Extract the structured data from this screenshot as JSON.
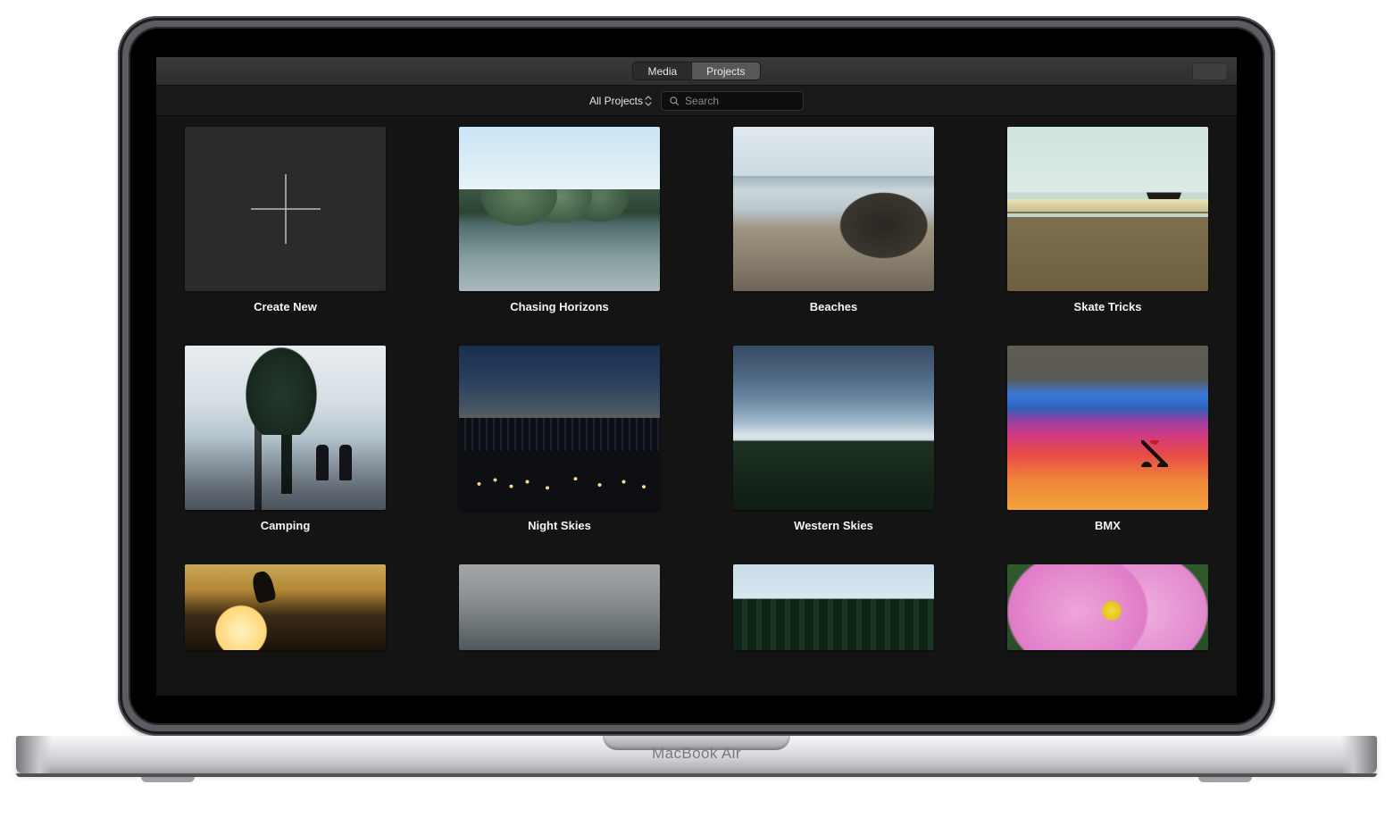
{
  "device": {
    "model_label": "MacBook Air"
  },
  "titlebar": {
    "tabs": {
      "media": "Media",
      "projects": "Projects"
    },
    "active_tab": "projects"
  },
  "toolbar": {
    "scope_label": "All Projects",
    "search": {
      "placeholder": "Search",
      "value": ""
    }
  },
  "projects": {
    "create_label": "Create New",
    "items": [
      {
        "title": "Chasing Horizons"
      },
      {
        "title": "Beaches"
      },
      {
        "title": "Skate Tricks"
      },
      {
        "title": "Camping"
      },
      {
        "title": "Night Skies"
      },
      {
        "title": "Western Skies"
      },
      {
        "title": "BMX"
      }
    ]
  }
}
